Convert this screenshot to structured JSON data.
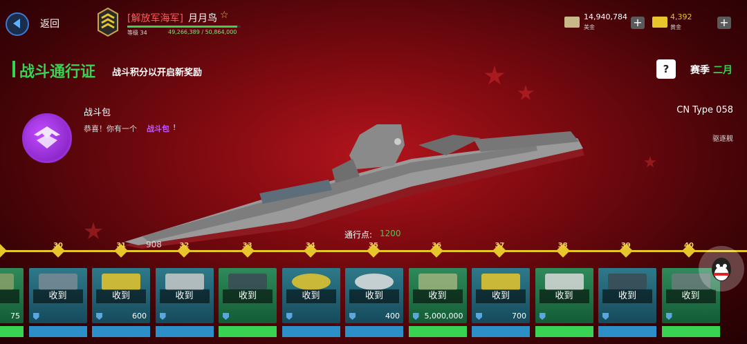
{
  "header": {
    "back_label": "返回",
    "player_tag": "[解放军海军]",
    "player_name": "月月鸟",
    "level_text": "等级 34",
    "xp_text": "49,266,389 / 50,864,000",
    "xp_progress": 0.97
  },
  "currencies": [
    {
      "value": "14,940,784",
      "label": "美金",
      "icon": "cash-icon",
      "color": "#c9b98a"
    },
    {
      "value": "4,392",
      "label": "黄金",
      "icon": "gold-bar-icon",
      "color": "#e8c62b"
    }
  ],
  "battle_pass": {
    "title": "战斗通行证",
    "subtitle": "战斗积分以开启新奖励",
    "season_label": "赛季",
    "season_value": "二月",
    "help_label": "?"
  },
  "pack": {
    "title": "战斗包",
    "desc_a": "恭喜！你有一个",
    "desc_b": "战斗包",
    "desc_c": "!"
  },
  "ship": {
    "name": "CN Type 058",
    "class": "驱逐舰"
  },
  "points": {
    "label": "通行点:",
    "value": "1200"
  },
  "track_levels": [
    "30",
    "31",
    "32",
    "33",
    "34",
    "35",
    "36",
    "37",
    "38",
    "39",
    "40"
  ],
  "rewards": [
    {
      "claimed": "到",
      "amount": "75",
      "style": "green",
      "item": "partial"
    },
    {
      "claimed": "收到",
      "amount": "",
      "style": "blue",
      "item": "turret"
    },
    {
      "claimed": "收到",
      "amount": "600",
      "style": "blue",
      "item": "gold"
    },
    {
      "claimed": "收到",
      "amount": "",
      "style": "blue",
      "item": "missile"
    },
    {
      "claimed": "收到",
      "amount": "",
      "style": "green",
      "item": "submarine"
    },
    {
      "claimed": "收到",
      "amount": "",
      "style": "blue",
      "item": "rank-medal"
    },
    {
      "claimed": "收到",
      "amount": "400",
      "style": "blue",
      "item": "xp-boost"
    },
    {
      "claimed": "收到",
      "amount": "5,000,000",
      "style": "green",
      "item": "cash"
    },
    {
      "claimed": "收到",
      "amount": "700",
      "style": "blue",
      "item": "gold"
    },
    {
      "claimed": "收到",
      "amount": "",
      "style": "green",
      "item": "torpedo"
    },
    {
      "claimed": "收到",
      "amount": "",
      "style": "blue",
      "item": "submarine"
    },
    {
      "claimed": "收到",
      "amount": "",
      "style": "green",
      "item": "ship"
    }
  ]
}
